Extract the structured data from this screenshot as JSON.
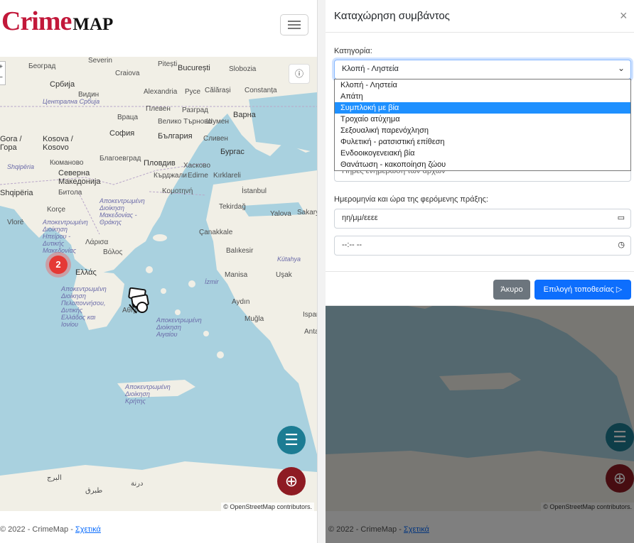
{
  "app": {
    "logo_part1": "Crime",
    "logo_part2": "MAP"
  },
  "icons": {
    "menu": "hamburger-icon",
    "info": "ⓘ",
    "filter": "☰",
    "add": "⊕",
    "close": "×",
    "chevron": "⌄",
    "calendar": "▭",
    "clock": "◷",
    "arrow": "▷"
  },
  "map": {
    "zoom_in": "+",
    "zoom_out": "−",
    "cluster_count": "2",
    "attribution": "© OpenStreetMap contributors.",
    "labels": [
      "Београд",
      "Severin",
      "Craiova",
      "Pitești",
      "București",
      "Slobozia",
      "Србија",
      "Видин",
      "Alexandria",
      "Русе",
      "Călărași",
      "Constanța",
      "Централна Србија",
      "Плевен",
      "Разград",
      "Враца",
      "Велико Търново",
      "Шумен",
      "Варна",
      "Gora /",
      "Kosova /",
      "Гора",
      "Kosovo",
      "София",
      "България",
      "Сливен",
      "Благоевград",
      "Бургас",
      "Shqipëria",
      "Кюманово",
      "Пловдив",
      "Хасково",
      "Северна Македонија",
      "Кърджали",
      "Edirne",
      "Kırklareli",
      "Shqipëria",
      "Битола",
      "Κομοτηνή",
      "İstanbul",
      "Korçe",
      "Αποκεντρωμένη Διοίκηση Μακεδονίας - Θράκης",
      "Tekirdağ",
      "Vlorë",
      "Αποκεντρωμένη Διοίκηση Ηπείρου - Δυτικής Μακεδονίας",
      "Yalova",
      "Sakarya",
      "Λάρισα",
      "Çanakkale",
      "Balıkesir",
      "Βόλος",
      "Ελλάς",
      "Manisa",
      "Uşak",
      "Kütahya",
      "İzmir",
      "Αποκεντρωμένη Διοίκηση Πελοποννήσου, Δυτικής Ελλάδος και Ιονίου",
      "Αθήνα",
      "Αποκεντρωμένη Διοίκηση Αιγαίου",
      "Aydın",
      "Isparta",
      "Muğla",
      "Antalya",
      "Αποκεντρωμένη Διοίκηση Κρήτης",
      "البرج",
      "طبرق",
      "درنة"
    ]
  },
  "footer": {
    "copyright": "© 2022 - CrimeMap - ",
    "link": "Σχετικά"
  },
  "modal": {
    "title": "Καταχώρηση συμβάντος",
    "category_label": "Κατηγορία:",
    "category_selected": "Κλοπή - Ληστεία",
    "category_options": [
      "Κλοπή - Ληστεία",
      "Απάτη",
      "Συμπλοκή με βία",
      "Τροχαίο ατύχημα",
      "Σεξουαλική παρενόχληση",
      "Φυλετική - ρατσιστική επίθεση",
      "Ενδοοικογενειακή βία",
      "Θανάτωση - κακοποίηση ζώου"
    ],
    "hidden_field_text": "Πήρες ενημέρωση των αρχών",
    "datetime_label": "Ημερομηνία και ώρα της φερόμενης πράξης:",
    "date_placeholder": "ηη/μμ/εεεε",
    "time_placeholder": "--:-- --",
    "cancel_label": "Άκυρο",
    "select_location_label": "Επιλογή τοποθεσίας"
  },
  "colors": {
    "brand": "#c2183a",
    "primary": "#0d6efd",
    "secondary": "#6c757d",
    "fab_filter": "#1c7c93",
    "fab_add": "#8e1b23",
    "cluster": "#e53935",
    "sea": "#a9d1df"
  }
}
